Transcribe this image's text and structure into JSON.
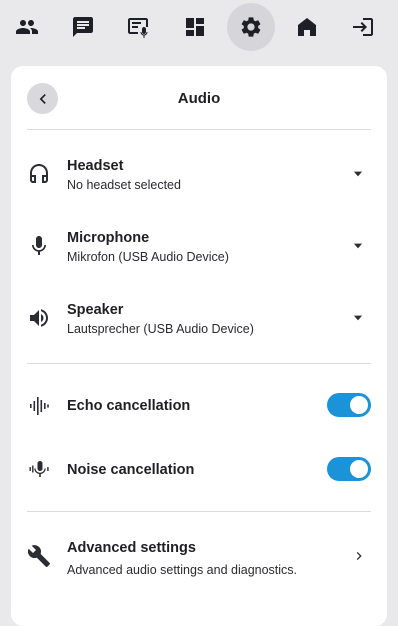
{
  "toolbar": {
    "items": [
      {
        "icon": "people-icon"
      },
      {
        "icon": "chat-icon"
      },
      {
        "icon": "presentation-mic-icon"
      },
      {
        "icon": "apps-grid-icon"
      },
      {
        "icon": "gear-icon",
        "active": true
      },
      {
        "icon": "home-icon"
      },
      {
        "icon": "exit-icon"
      }
    ]
  },
  "panel": {
    "title": "Audio",
    "devices": [
      {
        "label": "Headset",
        "value": "No headset selected",
        "icon": "headset-icon"
      },
      {
        "label": "Microphone",
        "value": "Mikrofon (USB Audio Device)",
        "icon": "microphone-icon"
      },
      {
        "label": "Speaker",
        "value": "Lautsprecher (USB Audio Device)",
        "icon": "speaker-icon"
      }
    ],
    "toggles": [
      {
        "label": "Echo cancellation",
        "on": true,
        "icon": "waveform-icon"
      },
      {
        "label": "Noise cancellation",
        "on": true,
        "icon": "noise-mic-icon"
      }
    ],
    "advanced": {
      "label": "Advanced settings",
      "description": "Advanced audio settings and diagnostics.",
      "icon": "wrench-icon"
    }
  },
  "colors": {
    "background": "#e9e9eb",
    "panel": "#ffffff",
    "accent": "#1b93d9",
    "active_tab": "#d6d6da"
  }
}
